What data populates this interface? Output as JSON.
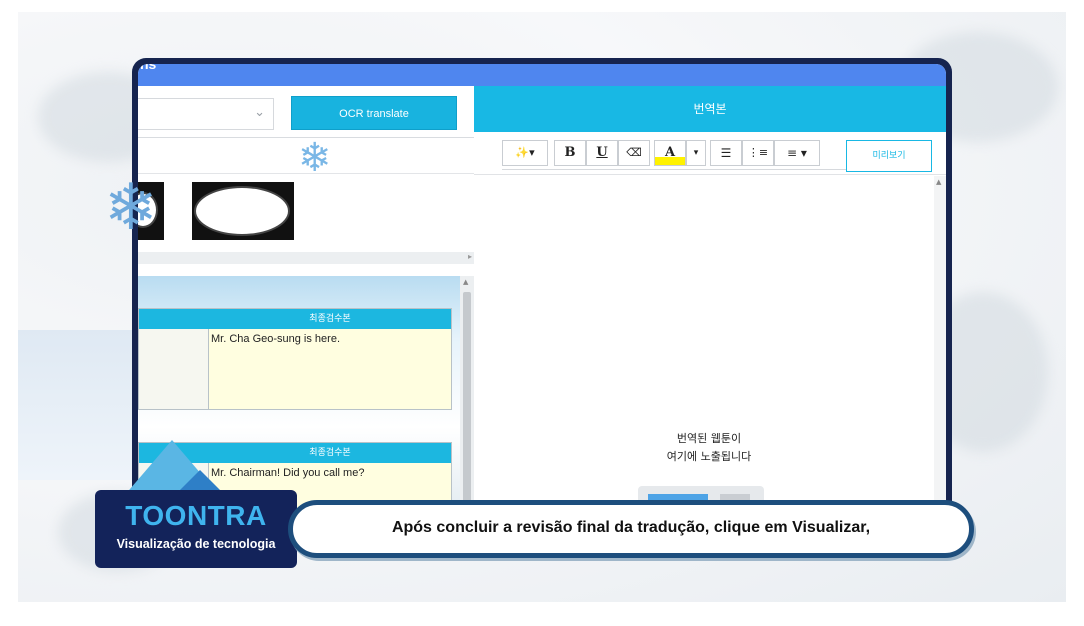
{
  "app": {
    "brand_partial": "ns"
  },
  "left_panel": {
    "select_value": "",
    "ocr_button_label": "OCR translate",
    "cards": [
      {
        "header": "최종검수본",
        "text": "Mr. Cha Geo-sung is here."
      },
      {
        "header": "최종검수본",
        "text": "Mr. Chairman! Did you call me?"
      }
    ]
  },
  "right_panel": {
    "header": "번역본",
    "preview_button_label": "미리보기",
    "placeholder_line1": "번역된 웹툰이",
    "placeholder_line2": "여기에 노출됩니다",
    "toolbar": {
      "magic_label": "✨▾",
      "bold_label": "B",
      "underline_label": "U",
      "eraser_label": "⌫",
      "color_label": "A",
      "color_dropdown_label": "▾",
      "bullet_list_label": "☰",
      "numbered_list_label": "⋮≡",
      "align_label": "≡ ▾"
    }
  },
  "overlay": {
    "logo_title": "TOONTRA",
    "logo_subtitle": "Visualização de tecnologia",
    "caption": "Após concluir a revisão final da tradução, clique em Visualizar,"
  },
  "colors": {
    "accent": "#18b8e4",
    "topbar": "#4f86ef",
    "frame": "#16244f",
    "card_bg": "#fffee0"
  }
}
